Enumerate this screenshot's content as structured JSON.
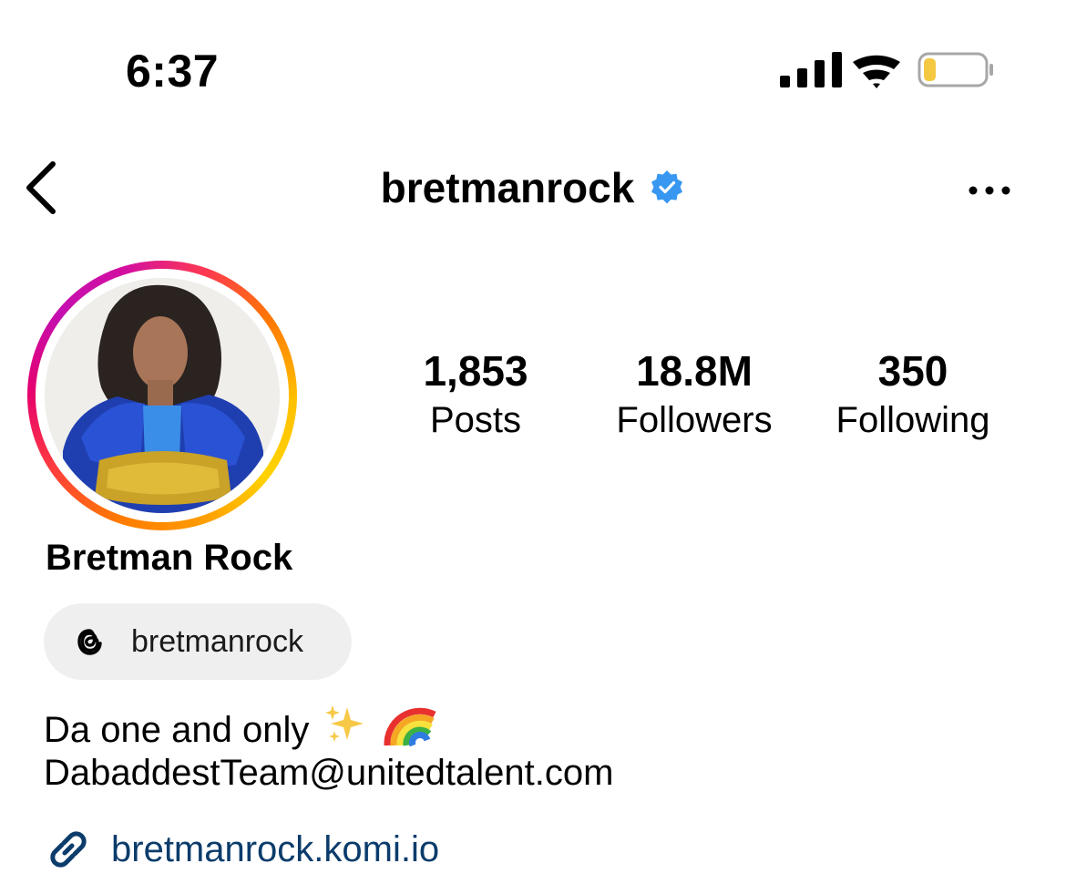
{
  "status_bar": {
    "time": "6:37",
    "icons": [
      "cellular-signal-icon",
      "wifi-icon",
      "battery-icon"
    ],
    "battery_level": 0.2,
    "battery_color": "#f5c842"
  },
  "header": {
    "username": "bretmanrock",
    "verified": true,
    "verified_color": "#3897f0",
    "back_icon": "chevron-left-icon",
    "more_icon": "more-horizontal-icon"
  },
  "profile": {
    "avatar_icon": "profile-avatar",
    "stats": [
      {
        "value": "1,853",
        "label": "Posts"
      },
      {
        "value": "18.8M",
        "label": "Followers"
      },
      {
        "value": "350",
        "label": "Following"
      }
    ],
    "full_name": "Bretman Rock",
    "threads": {
      "icon": "threads-icon",
      "handle": "bretmanrock"
    },
    "bio": {
      "line1": "Da one and only",
      "line1_emojis": [
        "sparkles-icon",
        "rainbow-icon"
      ],
      "line2": "DabaddestTeam@unitedtalent.com"
    },
    "link": {
      "icon": "link-icon",
      "text": "bretmanrock.komi.io",
      "color": "#0b3c6b"
    }
  }
}
